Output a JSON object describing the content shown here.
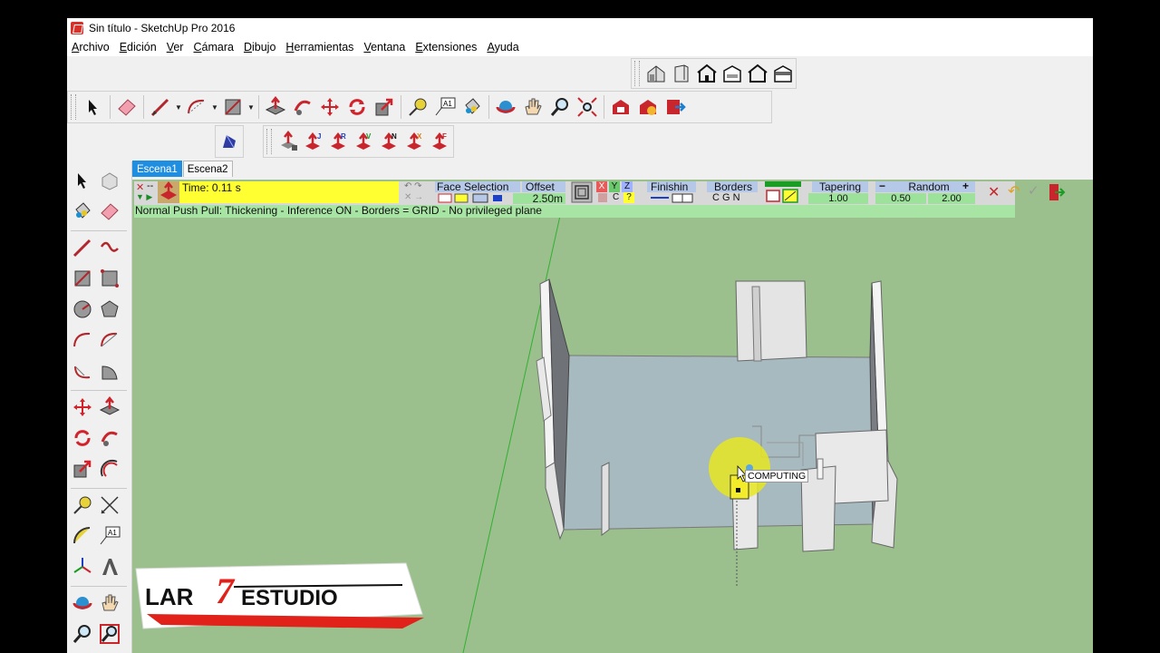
{
  "window": {
    "title": "Sin título - SketchUp Pro 2016"
  },
  "menu": {
    "items": [
      {
        "first": "A",
        "rest": "rchivo"
      },
      {
        "first": "E",
        "rest": "dición"
      },
      {
        "first": "V",
        "rest": "er"
      },
      {
        "first": "C",
        "rest": "ámara"
      },
      {
        "first": "D",
        "rest": "ibujo"
      },
      {
        "first": "H",
        "rest": "erramientas"
      },
      {
        "first": "V",
        "rest": "entana"
      },
      {
        "first": "E",
        "rest": "xtensiones"
      },
      {
        "first": "A",
        "rest": "yuda"
      }
    ]
  },
  "scenes": {
    "tabs": [
      "Escena1",
      "Escena2"
    ]
  },
  "pushpull": {
    "time": "Time: 0.11 s",
    "face_selection": "Face Selection",
    "offset_label": "Offset",
    "offset_value": "2.50m",
    "axis_x": "X",
    "axis_y": "Y",
    "axis_z": "Z",
    "axis_c": "C",
    "axis_q": "?",
    "finishing": "Finishin",
    "borders": "Borders",
    "borders_opts": "C  G  N",
    "tapering": "Tapering",
    "tapering_value": "1.00",
    "random": "Random",
    "random_min": "0.50",
    "random_max": "2.00",
    "minus": "−",
    "plus": "+",
    "status": "Normal Push Pull: Thickening - Inference ON - Borders = GRID - No privileged plane"
  },
  "viewport": {
    "computing_label": "COMPUTING"
  },
  "logo": {
    "part1": "LAR",
    "seven": "7",
    "part2": "ESTUDIO"
  },
  "colors": {
    "viewport_bg": "#9cbf8e",
    "scene_tab_active": "#1f8de0",
    "status_bg": "#a8e4a4",
    "logo_red": "#e0221b"
  }
}
